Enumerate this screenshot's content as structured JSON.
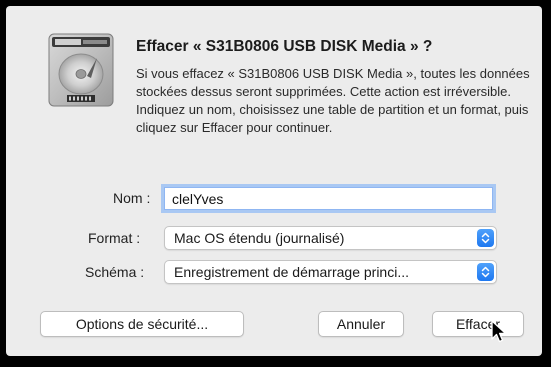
{
  "dialog": {
    "title": "Effacer « S31B0806 USB DISK Media » ?",
    "message": "Si vous effacez « S31B0806 USB DISK Media », toutes les données stockées dessus seront supprimées. Cette action est irréversible. Indiquez un nom, choisissez une table de partition et un format, puis cliquez sur Effacer pour continuer.",
    "icon": "external-disk-icon"
  },
  "form": {
    "name_label": "Nom :",
    "name_value": "clelYves",
    "format_label": "Format :",
    "format_value": "Mac OS étendu (journalisé)",
    "scheme_label": "Schéma :",
    "scheme_value": "Enregistrement de démarrage princi..."
  },
  "buttons": {
    "security_options": "Options de sécurité...",
    "cancel": "Annuler",
    "erase": "Effacer"
  },
  "colors": {
    "accent": "#1e78f0",
    "focus_ring": "#a9c8f3",
    "dialog_bg": "#ececec"
  }
}
